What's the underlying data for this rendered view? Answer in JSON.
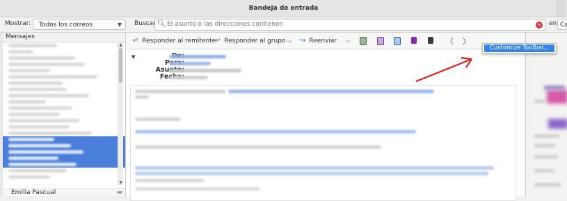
{
  "window": {
    "title": "Bandeja de entrada"
  },
  "filter": {
    "show_label": "Mostrar:",
    "show_value": "Todos los correos",
    "search_label": "Buscar:",
    "search_placeholder": "El asunto o las direcciones contienen",
    "in_label": "en",
    "in_value": "Ca"
  },
  "message_list": {
    "header": "Mensajes",
    "footer_sender": "Emilia Pascual"
  },
  "toolbar": {
    "reply_sender": "Responder al remitente",
    "reply_group": "Responder al grupo",
    "forward": "Reenviar",
    "prev": "〈",
    "next": "〉"
  },
  "message_header": {
    "from_label": "De:",
    "to_label": "Para:",
    "subject_label": "Asunto:",
    "date_label": "Fecha:"
  },
  "context_menu": {
    "customize_toolbar": "Customize Toolbar..."
  },
  "colors": {
    "selection": "#4a7fdc",
    "menu_highlight": "#3584e4",
    "annotation_arrow": "#e0201e"
  }
}
